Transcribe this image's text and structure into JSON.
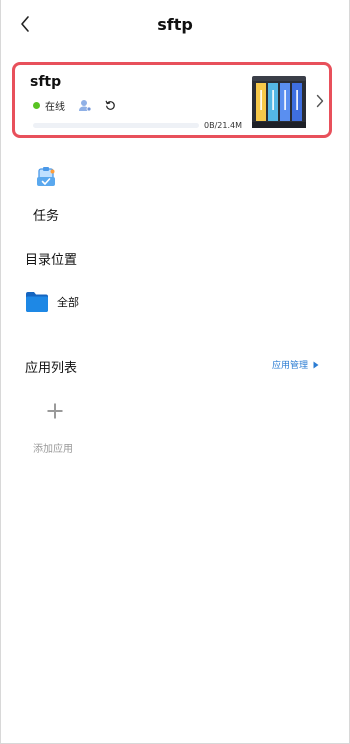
{
  "header": {
    "title": "sftp"
  },
  "device": {
    "name": "sftp",
    "status": "在线",
    "usage": "0B/21.4M",
    "usage_fraction": 0.0
  },
  "task": {
    "label": "任务"
  },
  "directory": {
    "title": "目录位置",
    "items": [
      {
        "label": "全部"
      }
    ]
  },
  "apps": {
    "title": "应用列表",
    "manage_label": "应用管理",
    "add_label": "添加应用"
  },
  "colors": {
    "accent": "#2b7cd3",
    "online": "#58c322",
    "highlight_border": "#e8505b",
    "folder": "#1e88e5"
  },
  "icons": {
    "back": "chevron-left-icon",
    "user": "user-icon",
    "refresh": "refresh-icon",
    "device": "nas-device-icon",
    "more": "chevron-right-icon",
    "task": "task-clipboard-icon",
    "folder": "folder-icon",
    "manage_arrow": "triangle-right-icon",
    "add": "plus-icon"
  }
}
